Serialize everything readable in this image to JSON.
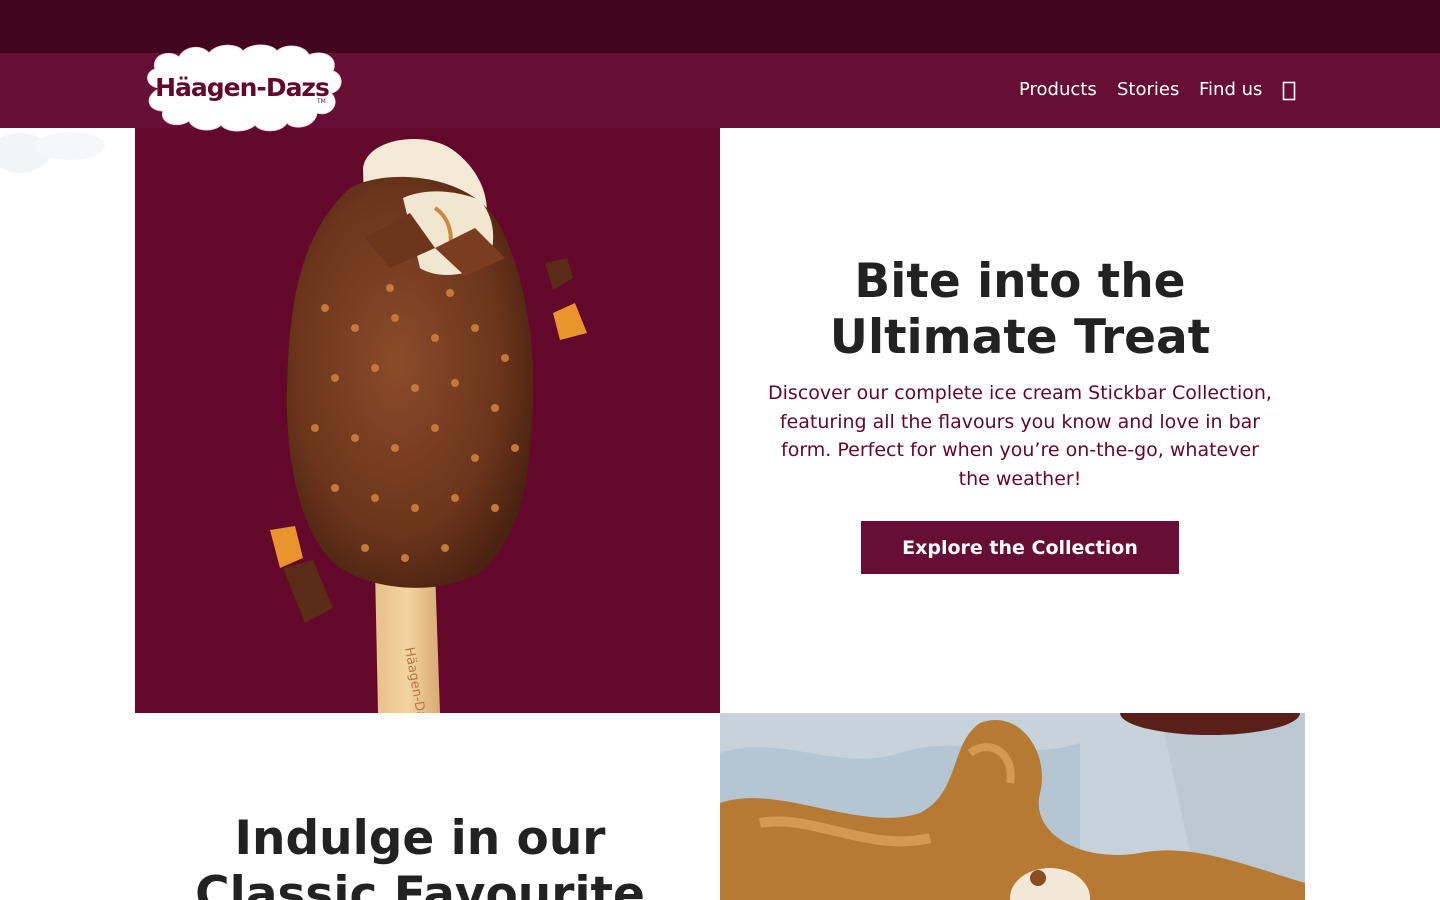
{
  "brand": {
    "name": "Häagen-Dazs",
    "trademark": "TM"
  },
  "nav": {
    "items": [
      {
        "label": "Products"
      },
      {
        "label": "Stories"
      },
      {
        "label": "Find us"
      }
    ],
    "icon": "location-icon"
  },
  "hero": {
    "title_line1": "Bite into the",
    "title_line2": "Ultimate Treat",
    "description": "Discover our complete ice cream Stickbar Collection, featuring all the flavours you know and love in bar form. Perfect for when you’re on-the-go, whatever the weather!",
    "cta_label": "Explore the Collection",
    "image_subject": "chocolate-coated ice cream stickbar with caramel pieces"
  },
  "second": {
    "title_line1": "Indulge in our",
    "title_line2": "Classic Favourite"
  },
  "colors": {
    "top_strip": "#420520",
    "nav_bar": "#660e33",
    "brand_burgundy": "#63082b",
    "heading": "#222222",
    "white": "#ffffff"
  }
}
